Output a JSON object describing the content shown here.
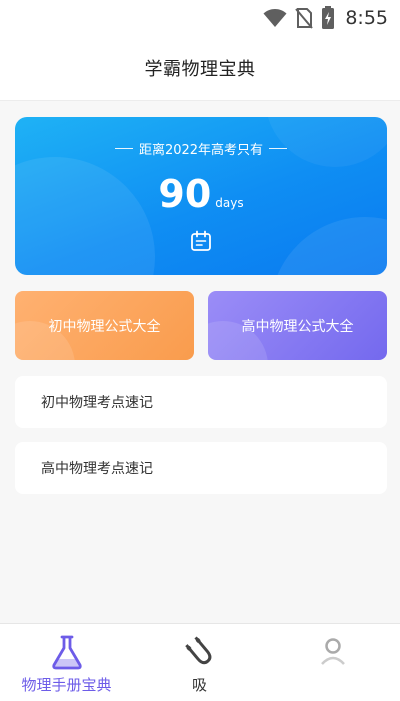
{
  "status_bar": {
    "time": "8:55",
    "icons": [
      "wifi-icon",
      "no-sim-icon",
      "battery-charging-icon"
    ]
  },
  "header": {
    "title": "学霸物理宝典"
  },
  "countdown": {
    "label": "距离2022年高考只有",
    "value": "90",
    "unit": "days",
    "icon": "calendar-icon"
  },
  "formula_buttons": [
    {
      "label": "初中物理公式大全",
      "color": "#f99c4d"
    },
    {
      "label": "高中物理公式大全",
      "color": "#7469ee"
    }
  ],
  "list_items": [
    {
      "label": "初中物理考点速记"
    },
    {
      "label": "高中物理考点速记"
    }
  ],
  "bottom_nav": [
    {
      "label": "物理手册宝典",
      "icon": "flask-icon",
      "active": true
    },
    {
      "label": "吸",
      "icon": "magnet-icon",
      "active": false
    },
    {
      "label": "",
      "icon": "user-icon",
      "active": false
    }
  ],
  "colors": {
    "accent": "#6d5ce8",
    "countdown_gradient_start": "#1fb2f5",
    "countdown_gradient_end": "#0a7af0"
  }
}
